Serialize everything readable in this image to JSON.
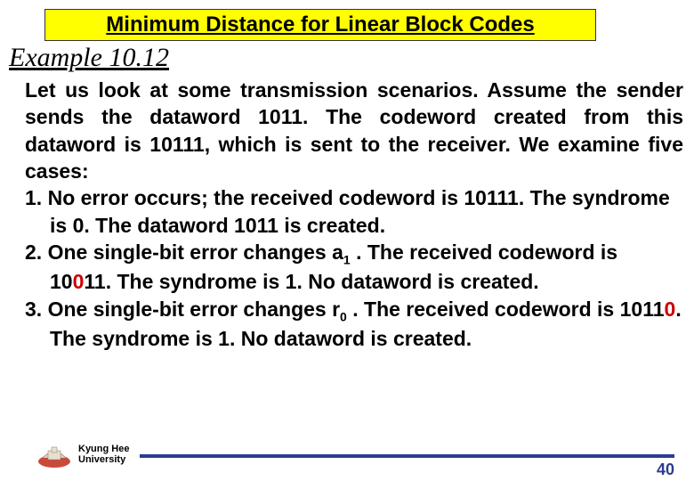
{
  "title": "Minimum Distance for Linear Block Codes",
  "example_label": "Example 10.12",
  "intro": "Let us look at some transmission scenarios. Assume the sender sends the dataword 1011. The codeword created from this dataword is 10111, which is sent to the receiver. We examine five cases:",
  "cases": {
    "c1": {
      "num": "1.",
      "text_a": "No error occurs; the received codeword is 10111. The syndrome is 0. The dataword 1011 is created."
    },
    "c2": {
      "num": "2.",
      "text_a": "One single-bit error changes a",
      "sub": "1",
      "text_b": " . The received codeword is 10",
      "red": "0",
      "text_c": "11. The syndrome is 1. No dataword is created."
    },
    "c3": {
      "num": "3.",
      "text_a": "One single-bit error changes r",
      "sub": "0",
      "text_b": " . The received codeword is 1011",
      "red": "0",
      "text_c": ". The syndrome is 1. No dataword is created."
    }
  },
  "university": {
    "line1": "Kyung Hee",
    "line2": "University"
  },
  "page_number": "40"
}
